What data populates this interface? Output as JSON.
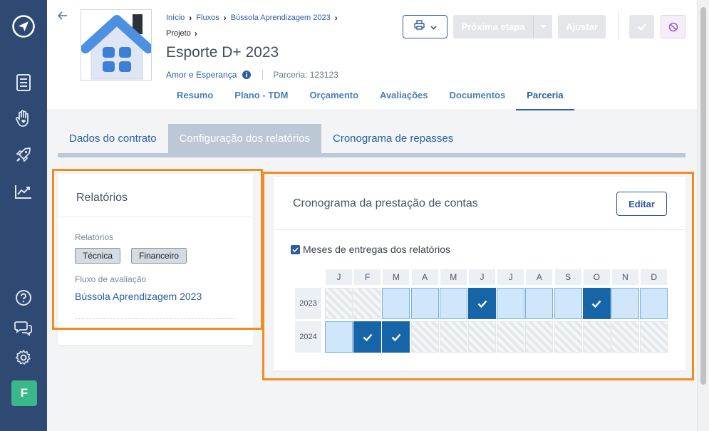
{
  "sidebar": {
    "icons": [
      "logo-icon",
      "document-icon",
      "hand-heart-icon",
      "rocket-icon",
      "chart-icon",
      "help-icon",
      "chat-icon",
      "gear-icon"
    ],
    "avatar_initial": "F"
  },
  "header": {
    "breadcrumb": [
      "Início",
      "Fluxos",
      "Bússola Aprendizagem 2023"
    ],
    "sub_breadcrumb": "Projeto",
    "title": "Esporte D+ 2023",
    "org": "Amor e Esperança",
    "parceria": "Parceria: 123123",
    "tabs": [
      "Resumo",
      "Plano - TDM",
      "Orçamento",
      "Avaliações",
      "Documentos",
      "Parceria"
    ],
    "active_tab": "Parceria",
    "next_step_label": "Próxima etapa",
    "adjust_label": "Ajustar"
  },
  "subtabs": {
    "items": [
      "Dados do contrato",
      "Configuração dos relatórios",
      "Cronograma de repasses"
    ],
    "active": "Configuração dos relatórios"
  },
  "relatorios": {
    "title": "Relatórios",
    "types_label": "Relatórios",
    "tags": [
      "Técnica",
      "Financeiro"
    ],
    "flow_label": "Fluxo de avaliação",
    "flow_value": "Bússola Aprendizagem 2023"
  },
  "cronograma": {
    "title": "Cronograma da prestação de contas",
    "edit_label": "Editar",
    "checkbox_label": "Meses de entregas dos relatórios",
    "checkbox_checked": true,
    "months": [
      "J",
      "F",
      "M",
      "A",
      "M",
      "J",
      "J",
      "A",
      "S",
      "O",
      "N",
      "D"
    ],
    "rows": [
      {
        "year": "2023",
        "cells": [
          "off",
          "off",
          "avail",
          "avail",
          "avail",
          "on",
          "avail",
          "avail",
          "avail",
          "on",
          "avail",
          "avail"
        ]
      },
      {
        "year": "2024",
        "cells": [
          "avail",
          "on",
          "on",
          "off",
          "off",
          "off",
          "off",
          "off",
          "off",
          "off",
          "off",
          "off"
        ]
      }
    ]
  },
  "colors": {
    "sidebar": "#2e4a73",
    "accent": "#2a5ea0",
    "selected_month": "#1665a8",
    "available_month": "#cfe6fb",
    "highlight": "#f58a1f"
  }
}
